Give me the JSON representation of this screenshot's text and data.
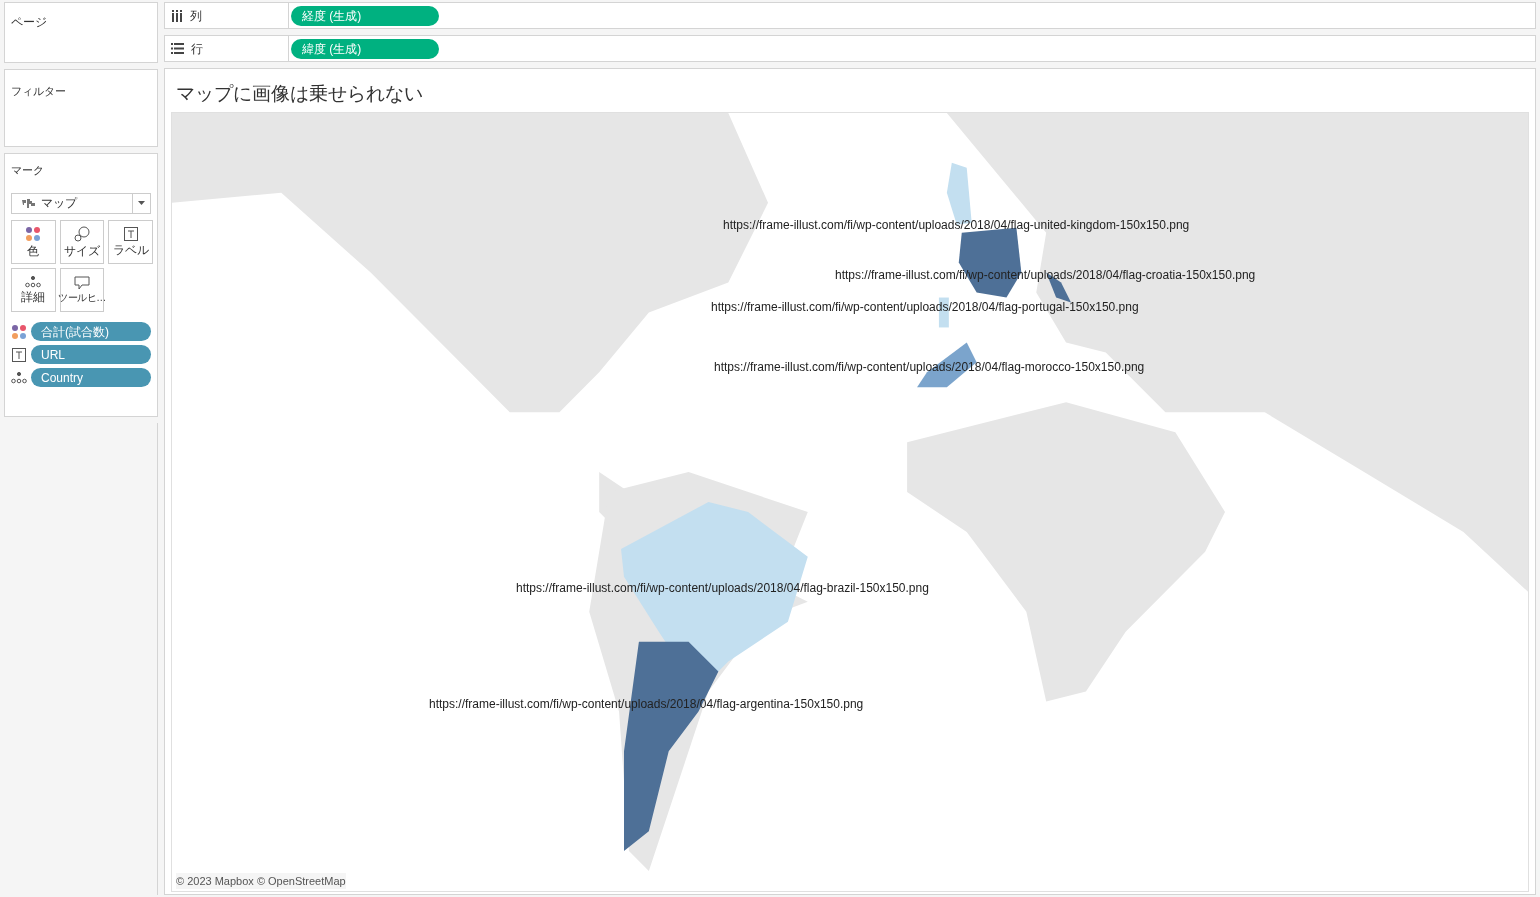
{
  "panels": {
    "pages": {
      "title": "ページ"
    },
    "filters": {
      "title": "フィルター"
    },
    "marks": {
      "title": "マーク",
      "mark_type": "マップ",
      "buttons": [
        {
          "kind": "color",
          "label": "色"
        },
        {
          "kind": "size",
          "label": "サイズ"
        },
        {
          "kind": "label",
          "label": "ラベル"
        },
        {
          "kind": "detail",
          "label": "詳細"
        },
        {
          "kind": "tooltip",
          "label": "ツールヒ…"
        }
      ],
      "fields": [
        {
          "kind": "color",
          "label": "合計(試合数)"
        },
        {
          "kind": "label",
          "label": "URL"
        },
        {
          "kind": "detail",
          "label": "Country"
        }
      ]
    }
  },
  "shelves": [
    {
      "kind": "columns",
      "label": "列",
      "pill": "経度 (生成)"
    },
    {
      "kind": "rows",
      "label": "行",
      "pill": "緯度 (生成)"
    }
  ],
  "view": {
    "title": "マップに画像は乗せられない",
    "labels": [
      "https://frame-illust.com/fi/wp-content/uploads/2018/04/flag-united-kingdom-150x150.png",
      "https://frame-illust.com/fi/wp-content/uploads/2018/04/flag-croatia-150x150.png",
      "https://frame-illust.com/fi/wp-content/uploads/2018/04/flag-portugal-150x150.png",
      "https://frame-illust.com/fi/wp-content/uploads/2018/04/flag-morocco-150x150.png",
      "https://frame-illust.com/fi/wp-content/uploads/2018/04/flag-brazil-150x150.png",
      "https://frame-illust.com/fi/wp-content/uploads/2018/04/flag-argentina-150x150.png"
    ],
    "attribution": "© 2023 Mapbox © OpenStreetMap"
  }
}
